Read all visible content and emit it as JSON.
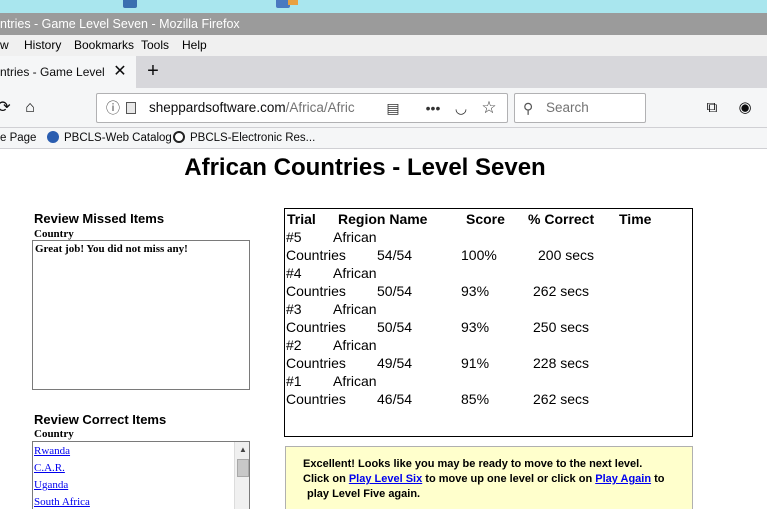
{
  "browser": {
    "window_title": "ntries - Game Level Seven - Mozilla Firefox",
    "menu": [
      "w",
      "History",
      "Bookmarks",
      "Tools",
      "Help"
    ],
    "tab_title": "ntries - Game Level Se",
    "tab_close": "✕",
    "new_tab": "+",
    "url_host": "sheppardsoftware.com",
    "url_path": "/Africa/Afric",
    "search_placeholder": "Search",
    "bookmarks": [
      "e Page",
      "PBCLS-Web Catalog",
      "PBCLS-Electronic Res..."
    ]
  },
  "page": {
    "title": "African Countries - Level Seven"
  },
  "missed": {
    "heading": "Review Missed Items",
    "column": "Country",
    "message": "Great job! You did not miss any!"
  },
  "correct": {
    "heading": "Review Correct Items",
    "column": "Country",
    "items": [
      "Rwanda",
      "C.A.R.",
      "Uganda",
      "South Africa"
    ]
  },
  "scores": {
    "headers": [
      "Trial",
      "Region Name",
      "Score",
      "% Correct",
      "Time"
    ],
    "rows": [
      {
        "trial": "#5",
        "region_a": "African",
        "region_b": "Countries",
        "score": "54/54",
        "pct": "100%",
        "time": "200 secs"
      },
      {
        "trial": "#4",
        "region_a": "African",
        "region_b": "Countries",
        "score": "50/54",
        "pct": "93%",
        "time": "262 secs"
      },
      {
        "trial": "#3",
        "region_a": "African",
        "region_b": "Countries",
        "score": "50/54",
        "pct": "93%",
        "time": "250 secs"
      },
      {
        "trial": "#2",
        "region_a": "African",
        "region_b": "Countries",
        "score": "49/54",
        "pct": "91%",
        "time": "228 secs"
      },
      {
        "trial": "#1",
        "region_a": "African",
        "region_b": "Countries",
        "score": "46/54",
        "pct": "85%",
        "time": "262 secs"
      }
    ]
  },
  "message": {
    "line1": "Excellent! Looks like you may be ready to move to the next level.",
    "line2_a": "Click on ",
    "link1": "Play Level Six",
    "line2_b": " to move up one level or click on ",
    "link2": "Play Again",
    "line2_c": " to",
    "line3": "play Level Five again."
  }
}
